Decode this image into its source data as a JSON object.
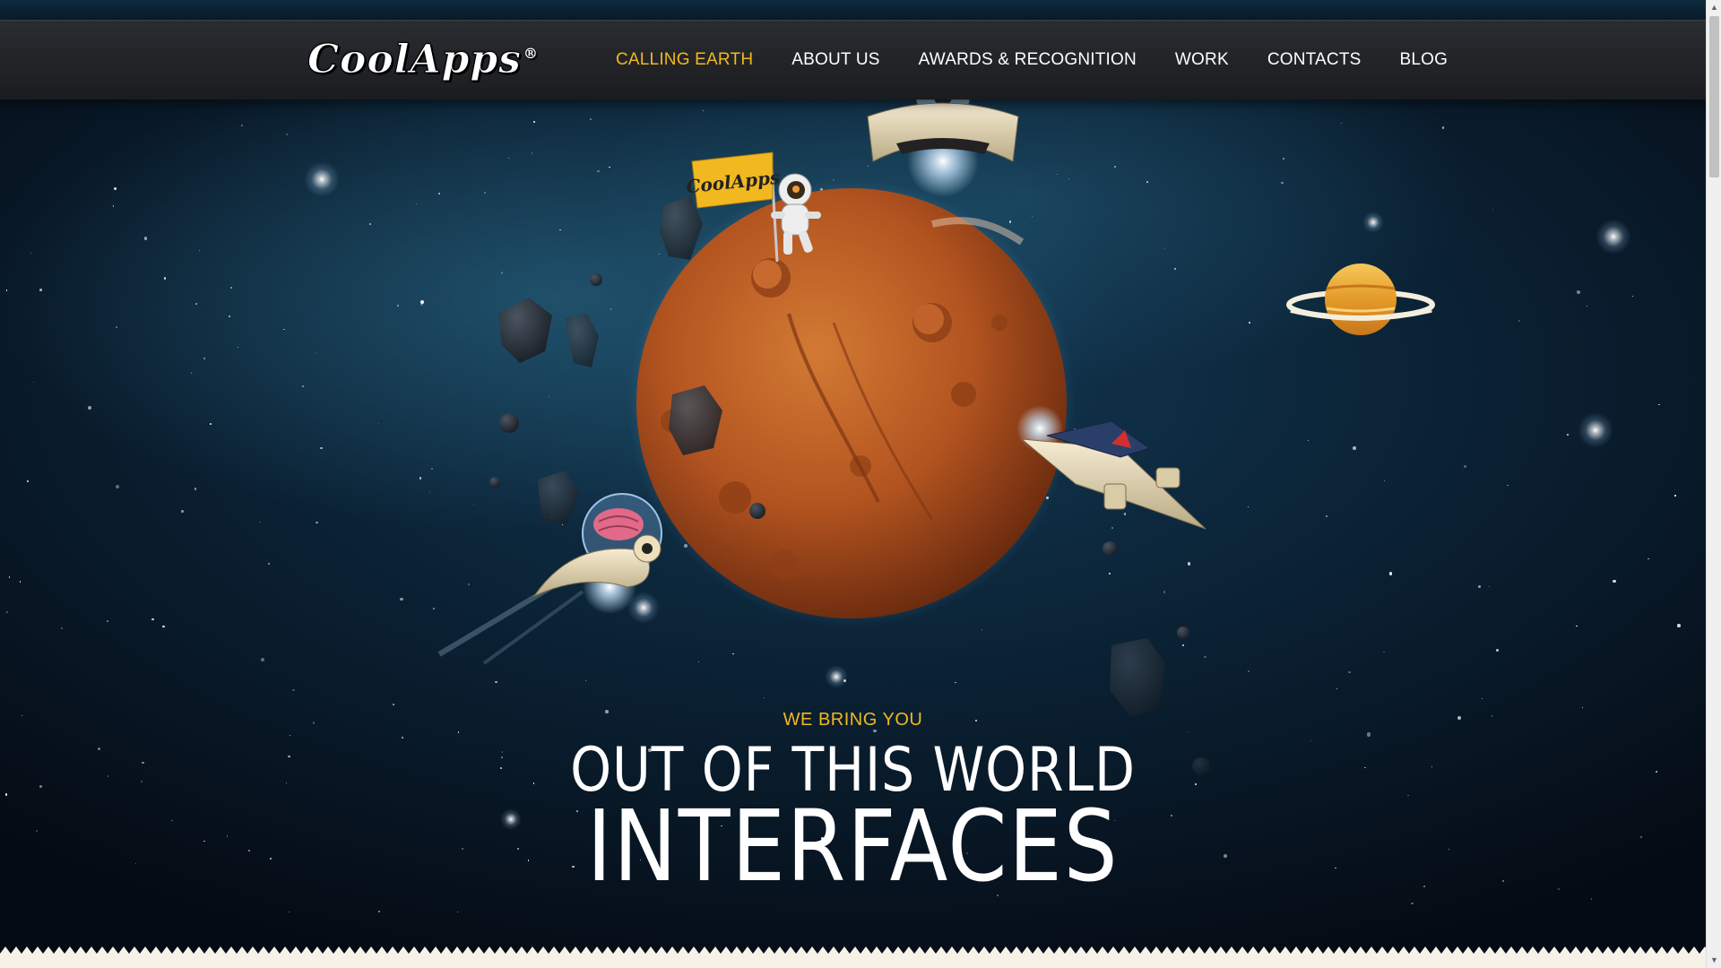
{
  "brand": {
    "logo_text": "CoolApps",
    "logo_mark": "®",
    "flag_text": "CoolApps"
  },
  "nav": {
    "items": [
      {
        "label": "CALLING EARTH",
        "active": true
      },
      {
        "label": "ABOUT US",
        "active": false
      },
      {
        "label": "AWARDS & RECOGNITION",
        "active": false
      },
      {
        "label": "WORK",
        "active": false
      },
      {
        "label": "CONTACTS",
        "active": false
      },
      {
        "label": "BLOG",
        "active": false
      }
    ]
  },
  "hero": {
    "eyebrow": "WE BRING YOU",
    "line1": "OUT OF THIS WORLD",
    "line2": "INTERFACES"
  },
  "colors": {
    "accent": "#f2b820",
    "nav_bg": "#1f2124",
    "planet": "#b85a22",
    "space": "#0b2336"
  },
  "icons": {
    "scroll_up": "▲",
    "scroll_down": "▼"
  }
}
